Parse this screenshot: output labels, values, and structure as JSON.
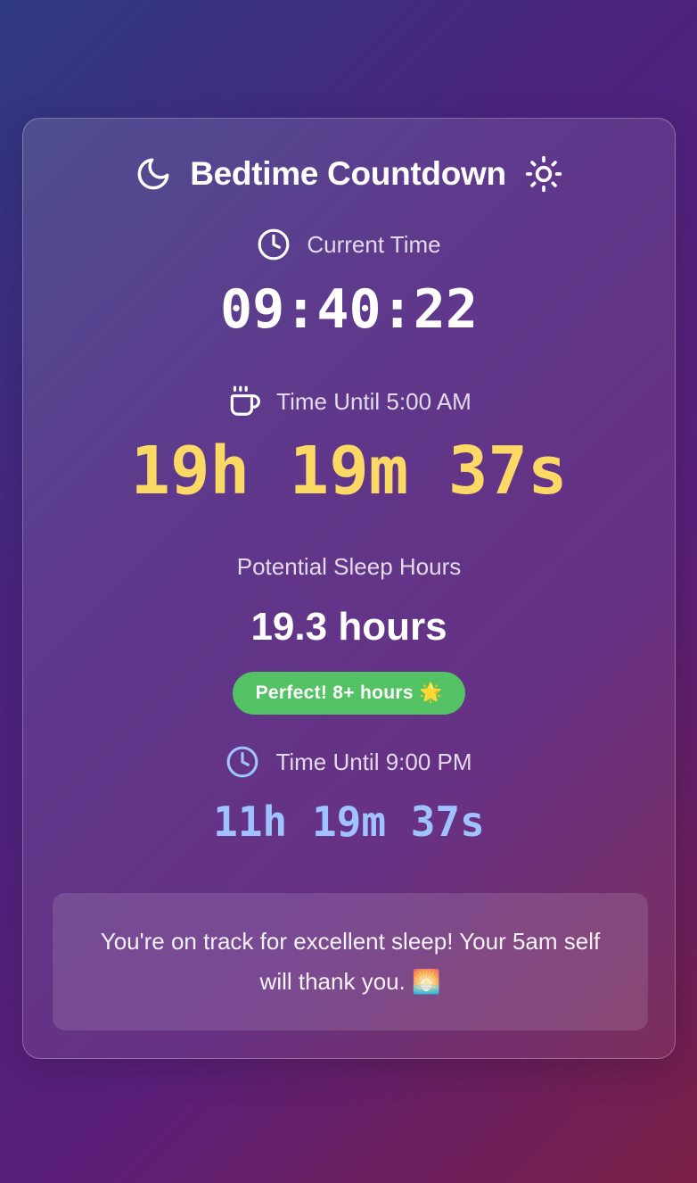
{
  "header": {
    "title": "Bedtime Countdown",
    "left_icon": "moon-icon",
    "right_icon": "sun-icon"
  },
  "current": {
    "label": "Current Time",
    "icon": "clock-icon",
    "value": "09:40:22"
  },
  "wake": {
    "label": "Time Until 5:00 AM",
    "icon": "coffee-cup-icon",
    "value": "19h 19m 37s"
  },
  "sleep": {
    "label": "Potential Sleep Hours",
    "value": "19.3 hours",
    "badge": "Perfect! 8+ hours 🌟"
  },
  "bedtime": {
    "label": "Time Until 9:00 PM",
    "icon": "clock-icon",
    "value": "11h 19m 37s"
  },
  "note": {
    "text": "You're on track for excellent sleep! Your 5am self will thank you. 🌅"
  },
  "colors": {
    "wake_value": "#fcd965",
    "bedtime_value": "#9ec3ff",
    "badge": "#52c265"
  }
}
